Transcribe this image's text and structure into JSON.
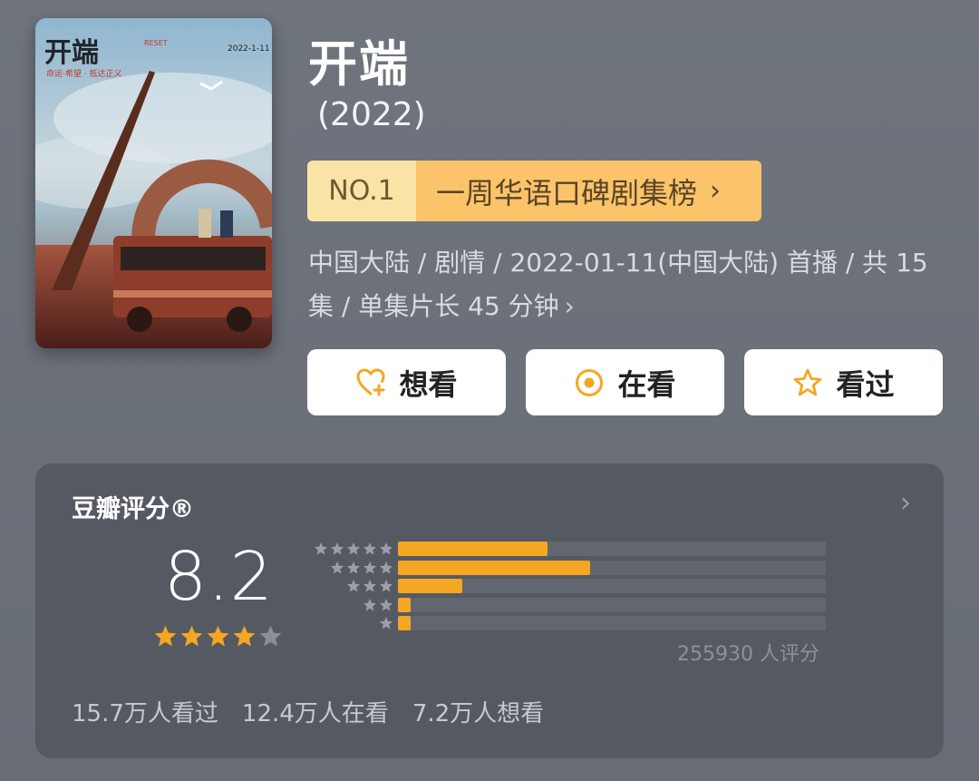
{
  "title": "开端",
  "year": "(2022)",
  "rank": {
    "no": "NO.1",
    "text": "一周华语口碑剧集榜"
  },
  "meta": "中国大陆 / 剧情 / 2022-01-11(中国大陆) 首播 / 共 15 集 / 单集片长 45 分钟",
  "actions": [
    {
      "label": "想看",
      "icon": "heart-plus-icon"
    },
    {
      "label": "在看",
      "icon": "target-icon"
    },
    {
      "label": "看过",
      "icon": "star-outline-icon"
    }
  ],
  "rating": {
    "header": "豆瓣评分®",
    "score": "8.2",
    "stars": 4,
    "distribution": [
      {
        "stars": 5,
        "percent": 35
      },
      {
        "stars": 4,
        "percent": 45
      },
      {
        "stars": 3,
        "percent": 15
      },
      {
        "stars": 2,
        "percent": 3
      },
      {
        "stars": 1,
        "percent": 3
      }
    ],
    "count_text": "255930 人评分",
    "stats": [
      "15.7万人看过",
      "12.4万人在看",
      "7.2万人想看"
    ]
  },
  "poster": {
    "logo_text": "开端",
    "logo_en": "RESET",
    "tagline": "命运·希望 · 抵达正义",
    "date": "2022-1-11"
  },
  "colors": {
    "accent": "#f5a623",
    "rank_no_bg": "#fae3a6",
    "rank_text_bg": "#fbc46a",
    "card_bg": "#555a62",
    "bar_track": "#62676f",
    "star_empty": "#8c9096"
  }
}
